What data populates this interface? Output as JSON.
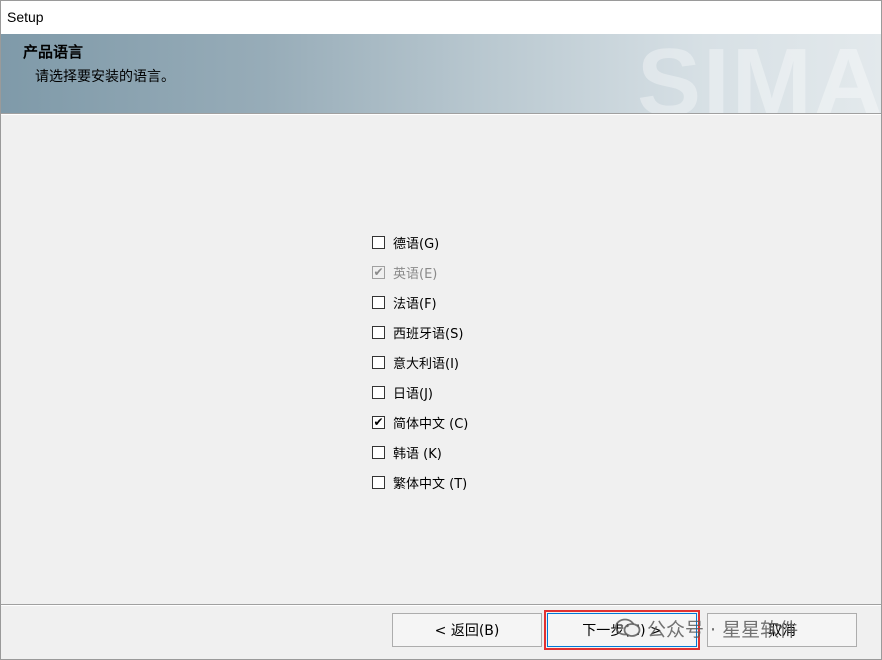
{
  "window": {
    "title": "Setup",
    "brand_watermark": "SIMA"
  },
  "header": {
    "title": "产品语言",
    "subtitle": "请选择要安装的语言。"
  },
  "languages": [
    {
      "label": "德语(G)",
      "checked": false,
      "disabled": false
    },
    {
      "label": "英语(E)",
      "checked": true,
      "disabled": true
    },
    {
      "label": "法语(F)",
      "checked": false,
      "disabled": false
    },
    {
      "label": "西班牙语(S)",
      "checked": false,
      "disabled": false
    },
    {
      "label": "意大利语(I)",
      "checked": false,
      "disabled": false
    },
    {
      "label": "日语(J)",
      "checked": false,
      "disabled": false
    },
    {
      "label": "简体中文 (C)",
      "checked": true,
      "disabled": false
    },
    {
      "label": "韩语 (K)",
      "checked": false,
      "disabled": false
    },
    {
      "label": "繁体中文 (T)",
      "checked": false,
      "disabled": false
    }
  ],
  "buttons": {
    "back": "< 返回(B)",
    "next": "下一步(N) >",
    "cancel": "取消"
  },
  "overlay": {
    "text": "公众号 · 星星软件",
    "icon": "wechat-icon"
  },
  "colors": {
    "focus_highlight": "#e03030",
    "default_button_border": "#0078d7"
  }
}
